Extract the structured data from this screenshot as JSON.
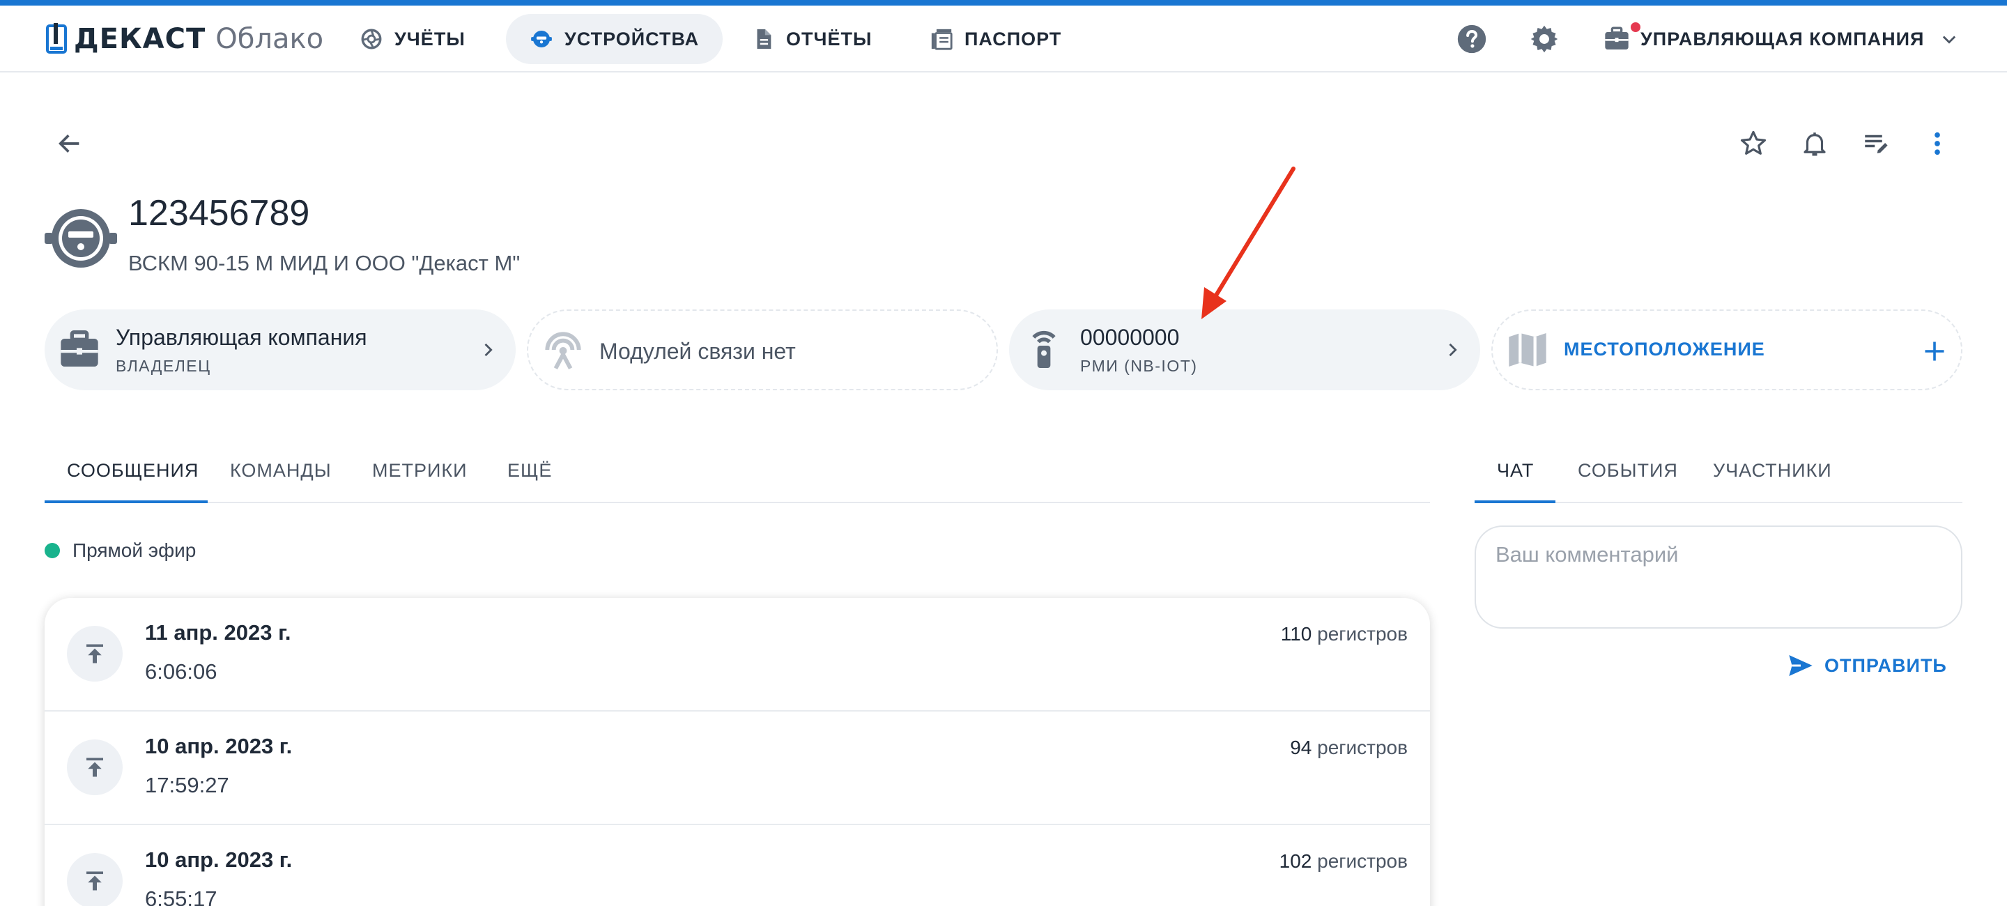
{
  "colors": {
    "accent": "#1976d2",
    "live": "#19b38d",
    "notification_dot": "#e53950",
    "annotation_arrow": "#e8321c"
  },
  "header": {
    "brand": "ДЕКАСТ",
    "brand_sub": "Облако",
    "nav": [
      {
        "label": "УЧЁТЫ",
        "icon": "aperture-icon"
      },
      {
        "label": "УСТРОЙСТВА",
        "icon": "meter-icon",
        "active": true
      },
      {
        "label": "ОТЧЁТЫ",
        "icon": "document-icon"
      },
      {
        "label": "ПАСПОРТ",
        "icon": "library-icon"
      }
    ],
    "company": "УПРАВЛЯЮЩАЯ КОМПАНИЯ"
  },
  "device": {
    "number": "123456789",
    "model": "ВСКМ 90-15 М МИД И ООО \"Декаст М\""
  },
  "cards": {
    "owner_title": "Управляющая компания",
    "owner_sub": "ВЛАДЕЛЕЦ",
    "modules_title": "Модулей связи нет",
    "rmi_title": "00000000",
    "rmi_sub": "РМИ (NB-IOT)",
    "location_label": "МЕСТОПОЛОЖЕНИЕ"
  },
  "main_tabs": [
    "СООБЩЕНИЯ",
    "КОМАНДЫ",
    "МЕТРИКИ",
    "ЕЩЁ"
  ],
  "side_tabs": [
    "ЧАТ",
    "СОБЫТИЯ",
    "УЧАСТНИКИ"
  ],
  "live_label": "Прямой эфир",
  "messages": [
    {
      "date": "11 апр. 2023 г.",
      "time": "6:06:06",
      "count": "110",
      "unit": "регистров"
    },
    {
      "date": "10 апр. 2023 г.",
      "time": "17:59:27",
      "count": "94",
      "unit": "регистров"
    },
    {
      "date": "10 апр. 2023 г.",
      "time": "6:55:17",
      "count": "102",
      "unit": "регистров"
    }
  ],
  "chat": {
    "placeholder": "Ваш комментарий",
    "send_label": "ОТПРАВИТЬ"
  }
}
